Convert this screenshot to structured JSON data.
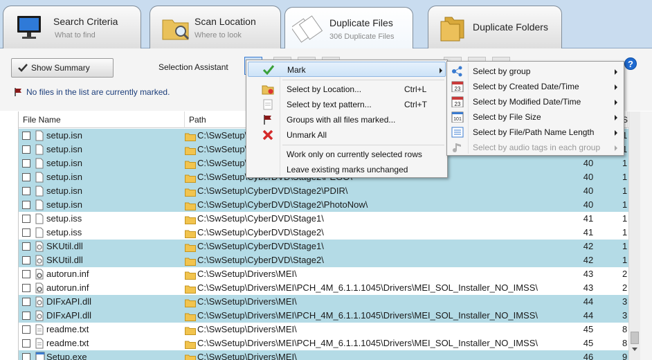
{
  "tabs": [
    {
      "title": "Search Criteria",
      "subtitle": "What to find",
      "icon": "monitor-icon",
      "active": false
    },
    {
      "title": "Scan Location",
      "subtitle": "Where to look",
      "icon": "folder-search-icon",
      "active": false
    },
    {
      "title": "Duplicate Files",
      "subtitle": "306 Duplicate Files",
      "icon": "duplicate-pages-icon",
      "active": true
    },
    {
      "title": "Duplicate Folders",
      "subtitle": "",
      "icon": "duplicate-folders-icon",
      "active": false
    }
  ],
  "toolbar": {
    "show_summary_label": "Show Summary",
    "selection_assistant_label": "Selection Assistant",
    "status_text": "No files in the list are currently marked.",
    "help_label": "?"
  },
  "grid": {
    "columns": [
      "File Name",
      "Path",
      "S"
    ],
    "rows": [
      {
        "name": "setup.isn",
        "path": "C:\\SwSetup\\CyberDVD\\Stage2\\",
        "group": "40",
        "size": "1",
        "highlight": true,
        "icon": "file-icon"
      },
      {
        "name": "setup.isn",
        "path": "C:\\SwSetup\\CyberDVD\\Stage2\\",
        "group": "40",
        "size": "1",
        "highlight": true,
        "icon": "file-icon"
      },
      {
        "name": "setup.isn",
        "path": "C:\\SwSetup\\CyberDVD\\Stage2\\",
        "group": "40",
        "size": "1",
        "highlight": true,
        "icon": "file-icon"
      },
      {
        "name": "setup.isn",
        "path": "C:\\SwSetup\\CyberDVD\\Stage2\\PEGO\\",
        "group": "40",
        "size": "1",
        "highlight": true,
        "icon": "file-icon"
      },
      {
        "name": "setup.isn",
        "path": "C:\\SwSetup\\CyberDVD\\Stage2\\PDIR\\",
        "group": "40",
        "size": "1",
        "highlight": true,
        "icon": "file-icon"
      },
      {
        "name": "setup.isn",
        "path": "C:\\SwSetup\\CyberDVD\\Stage2\\PhotoNow\\",
        "group": "40",
        "size": "1",
        "highlight": true,
        "icon": "file-icon"
      },
      {
        "name": "setup.iss",
        "path": "C:\\SwSetup\\CyberDVD\\Stage1\\",
        "group": "41",
        "size": "1",
        "highlight": false,
        "icon": "file-icon"
      },
      {
        "name": "setup.iss",
        "path": "C:\\SwSetup\\CyberDVD\\Stage2\\",
        "group": "41",
        "size": "1",
        "highlight": false,
        "icon": "file-icon"
      },
      {
        "name": "SKUtil.dll",
        "path": "C:\\SwSetup\\CyberDVD\\Stage1\\",
        "group": "42",
        "size": "1",
        "highlight": true,
        "icon": "dll-icon"
      },
      {
        "name": "SKUtil.dll",
        "path": "C:\\SwSetup\\CyberDVD\\Stage2\\",
        "group": "42",
        "size": "1",
        "highlight": true,
        "icon": "dll-icon"
      },
      {
        "name": "autorun.inf",
        "path": "C:\\SwSetup\\Drivers\\MEI\\",
        "group": "43",
        "size": "2",
        "highlight": false,
        "icon": "inf-icon"
      },
      {
        "name": "autorun.inf",
        "path": "C:\\SwSetup\\Drivers\\MEI\\PCH_4M_6.1.1.1045\\Drivers\\MEI_SOL_Installer_NO_IMSS\\",
        "group": "43",
        "size": "2",
        "highlight": false,
        "icon": "inf-icon"
      },
      {
        "name": "DIFxAPI.dll",
        "path": "C:\\SwSetup\\Drivers\\MEI\\",
        "group": "44",
        "size": "3",
        "highlight": true,
        "icon": "dll-icon"
      },
      {
        "name": "DIFxAPI.dll",
        "path": "C:\\SwSetup\\Drivers\\MEI\\PCH_4M_6.1.1.1045\\Drivers\\MEI_SOL_Installer_NO_IMSS\\",
        "group": "44",
        "size": "3",
        "highlight": true,
        "icon": "dll-icon"
      },
      {
        "name": "readme.txt",
        "path": "C:\\SwSetup\\Drivers\\MEI\\",
        "group": "45",
        "size": "8",
        "highlight": false,
        "icon": "text-file-icon"
      },
      {
        "name": "readme.txt",
        "path": "C:\\SwSetup\\Drivers\\MEI\\PCH_4M_6.1.1.1045\\Drivers\\MEI_SOL_Installer_NO_IMSS\\",
        "group": "45",
        "size": "8",
        "highlight": false,
        "icon": "text-file-icon"
      },
      {
        "name": "Setup.exe",
        "path": "C:\\SwSetup\\Drivers\\MEI\\",
        "group": "46",
        "size": "9",
        "highlight": true,
        "icon": "exe-icon"
      }
    ]
  },
  "menu": {
    "items": [
      {
        "label": "Mark",
        "shortcut": "",
        "submenu": true,
        "icon": "checkmark-icon",
        "highlighted": true
      },
      {
        "label": "Select by Location...",
        "shortcut": "Ctrl+L",
        "submenu": false,
        "icon": "folder-select-icon"
      },
      {
        "label": "Select by text pattern...",
        "shortcut": "Ctrl+T",
        "submenu": false,
        "icon": "text-pattern-icon"
      },
      {
        "label": "Groups with all files marked...",
        "shortcut": "",
        "submenu": false,
        "icon": "flag-icon"
      },
      {
        "label": "Unmark All",
        "shortcut": "",
        "submenu": false,
        "icon": "red-x-icon"
      },
      {
        "label": "Work only on currently selected rows",
        "shortcut": "",
        "submenu": false,
        "icon": ""
      },
      {
        "label": "Leave existing marks unchanged",
        "shortcut": "",
        "submenu": false,
        "icon": ""
      }
    ]
  },
  "submenu": {
    "items": [
      {
        "label": "Select by group",
        "icon": "group-icon",
        "enabled": true
      },
      {
        "label": "Select by Created Date/Time",
        "icon": "calendar-icon",
        "enabled": true
      },
      {
        "label": "Select by Modified Date/Time",
        "icon": "calendar-icon",
        "enabled": true
      },
      {
        "label": "Select by File Size",
        "icon": "file-size-icon",
        "enabled": true
      },
      {
        "label": "Select by File/Path Name Length",
        "icon": "name-length-icon",
        "enabled": true
      },
      {
        "label": "Select by audio tags in each group",
        "icon": "music-note-icon",
        "enabled": false
      }
    ],
    "calendar_day": "23",
    "size_code": "101"
  },
  "colors": {
    "row_highlight": "#b4dbe6",
    "accent": "#1f6ad0",
    "status_text": "#1b3d7a"
  }
}
